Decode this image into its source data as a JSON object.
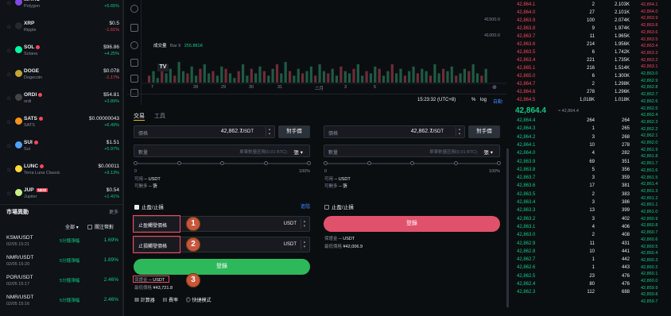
{
  "left_list": [
    {
      "symbol": "MATIC",
      "name": "Polygon",
      "price": "",
      "change": "+5.65%",
      "dir": "pos",
      "color": "#8247e5"
    },
    {
      "symbol": "XRP",
      "name": "Ripple",
      "price": "$0.5",
      "change": "-1.61%",
      "dir": "neg",
      "color": "#23292f"
    },
    {
      "symbol": "SOL",
      "name": "Solana",
      "price": "$96.86",
      "change": "+4.25%",
      "dir": "pos",
      "color": "#00ffa3",
      "hot": true
    },
    {
      "symbol": "DOGE",
      "name": "Dogecoin",
      "price": "$0.078",
      "change": "-1.17%",
      "dir": "neg",
      "color": "#c2a633"
    },
    {
      "symbol": "ORDI",
      "name": "ordi",
      "price": "$54.81",
      "change": "+3.89%",
      "dir": "pos",
      "color": "#444444",
      "hot": true
    },
    {
      "symbol": "SATS",
      "name": "SATS",
      "price": "$0.00000043",
      "change": "+6.49%",
      "dir": "pos",
      "color": "#f7931a",
      "hot": true
    },
    {
      "symbol": "SUI",
      "name": "Sui",
      "price": "$1.51",
      "change": "+5.97%",
      "dir": "pos",
      "color": "#4da2ff",
      "hot": true
    },
    {
      "symbol": "LUNC",
      "name": "Terra Luna Classic",
      "price": "$0.00011",
      "change": "+9.13%",
      "dir": "pos",
      "color": "#ffd83d",
      "hot": true
    },
    {
      "symbol": "JUP",
      "name": "Jupiter",
      "price": "$0.54",
      "change": "+1.41%",
      "dir": "pos",
      "color": "#c7f284",
      "badge": "NEW"
    }
  ],
  "movers": {
    "title": "市場異動",
    "more": "更多",
    "filter_all": "全部",
    "filter_fav": "關注幣對",
    "rows": [
      {
        "pair": "KSM/USDT",
        "time": "02/05 15:21",
        "tag": "5分鐘漲幅",
        "value": "1.69%"
      },
      {
        "pair": "NMR/USDT",
        "time": "02/05 15:20",
        "tag": "5分鐘漲幅",
        "value": "1.89%"
      },
      {
        "pair": "POR/USDT",
        "time": "02/05 15:17",
        "tag": "5分鐘漲幅",
        "value": "2.46%"
      },
      {
        "pair": "NMR/USDT",
        "time": "02/05 15:16",
        "tag": "5分鐘漲幅",
        "value": "2.46%"
      }
    ]
  },
  "chart": {
    "price_labels": [
      "41500.0",
      "41000.0"
    ],
    "volume_label": "成交量",
    "volume_value": "Bar 9",
    "volume_value2": "255.881K",
    "x_ticks": [
      "7",
      "28",
      "29",
      "30",
      "31",
      "二月",
      "3",
      "5"
    ],
    "bars": [
      3,
      5,
      2,
      8,
      4,
      6,
      3,
      9,
      5,
      4,
      7,
      3,
      6,
      8,
      4,
      5,
      3,
      7,
      6,
      4,
      2,
      5,
      8,
      3,
      6,
      4,
      7,
      5,
      3,
      6,
      8,
      4,
      9,
      5,
      3,
      6,
      4,
      5,
      7,
      3,
      8,
      5,
      4,
      6,
      3,
      7,
      5,
      4,
      6,
      8,
      3,
      5,
      4,
      7,
      6,
      3,
      5,
      8,
      4,
      6,
      3,
      5,
      7,
      4,
      6,
      5,
      3,
      8,
      4,
      6,
      5,
      7,
      3,
      4,
      6,
      5,
      8,
      4,
      3,
      6
    ],
    "time": "15:23:32 (UTC+8)",
    "pct": "%",
    "log": "log",
    "auto": "自動"
  },
  "form": {
    "tab_trade": "交易",
    "tab_tools": "工具",
    "price_label": "價格",
    "price_value": "42,862.7",
    "unit": "USDT",
    "counter_price_btn": "對手價",
    "qty_label": "數量",
    "qty_placeholder": "單筆數量區間(0.01 BTC)",
    "qty_unit": "張",
    "slider_min": "0",
    "slider_max": "100%",
    "avail_label": "可用",
    "avail_value": "-- USDT",
    "can_open_label": "可開多",
    "can_open_value": "-- 張",
    "tp_sl_label": "止盈/止損",
    "advanced": "進階",
    "tp_label": "止盈觸發價格",
    "sl_label": "止損觸發價格",
    "buy_label": "登錄",
    "sell_label": "登錄",
    "margin_label": "保證金",
    "margin_value": "-- USDT",
    "est_label": "最低價格",
    "est_value_buy": "¥43,721.8",
    "est_value_sell": "¥42,006.9",
    "calc": "計算器",
    "fee": "費率",
    "mode": "快捷模式",
    "callout_1": "1",
    "callout_2": "2",
    "callout_3": "3"
  },
  "book": {
    "asks": [
      {
        "price": "42,864.1",
        "qty": "2",
        "total": "2.103K"
      },
      {
        "price": "42,864.0",
        "qty": "27",
        "total": "2.101K"
      },
      {
        "price": "42,863.9",
        "qty": "100",
        "total": "2.074K"
      },
      {
        "price": "42,863.8",
        "qty": "9",
        "total": "1.974K"
      },
      {
        "price": "42,863.7",
        "qty": "11",
        "total": "1.965K"
      },
      {
        "price": "42,863.6",
        "qty": "214",
        "total": "1.956K"
      },
      {
        "price": "42,863.5",
        "qty": "6",
        "total": "1.742K"
      },
      {
        "price": "42,863.4",
        "qty": "221",
        "total": "1.735K"
      },
      {
        "price": "42,865.1",
        "qty": "216",
        "total": "1.514K"
      },
      {
        "price": "42,865.0",
        "qty": "6",
        "total": "1.300K"
      },
      {
        "price": "42,864.7",
        "qty": "2",
        "total": "1.298K"
      },
      {
        "price": "42,864.6",
        "qty": "278",
        "total": "1.296K"
      },
      {
        "price": "42,864.5",
        "qty": "1,018K",
        "total": "1.018K"
      }
    ],
    "mid_price": "42,864.4",
    "mid_sub": "≈ 42,864.4",
    "bids": [
      {
        "price": "42,864.4",
        "qty": "264",
        "total": "264"
      },
      {
        "price": "42,864.3",
        "qty": "1",
        "total": "265"
      },
      {
        "price": "42,864.2",
        "qty": "3",
        "total": "268"
      },
      {
        "price": "42,864.1",
        "qty": "10",
        "total": "278"
      },
      {
        "price": "42,864.0",
        "qty": "4",
        "total": "282"
      },
      {
        "price": "42,863.9",
        "qty": "69",
        "total": "351"
      },
      {
        "price": "42,863.8",
        "qty": "5",
        "total": "356"
      },
      {
        "price": "42,863.7",
        "qty": "3",
        "total": "359"
      },
      {
        "price": "42,863.6",
        "qty": "17",
        "total": "381"
      },
      {
        "price": "42,863.5",
        "qty": "2",
        "total": "383"
      },
      {
        "price": "42,863.4",
        "qty": "3",
        "total": "386"
      },
      {
        "price": "42,863.3",
        "qty": "13",
        "total": "399"
      },
      {
        "price": "42,863.2",
        "qty": "3",
        "total": "402"
      },
      {
        "price": "42,863.1",
        "qty": "4",
        "total": "406"
      },
      {
        "price": "42,863.0",
        "qty": "2",
        "total": "408"
      },
      {
        "price": "42,862.9",
        "qty": "11",
        "total": "431"
      },
      {
        "price": "42,862.8",
        "qty": "10",
        "total": "441"
      },
      {
        "price": "42,862.7",
        "qty": "1",
        "total": "442"
      },
      {
        "price": "42,862.6",
        "qty": "1",
        "total": "443"
      },
      {
        "price": "42,862.5",
        "qty": "23",
        "total": "476"
      },
      {
        "price": "42,862.4",
        "qty": "80",
        "total": "476"
      },
      {
        "price": "42,862.3",
        "qty": "112",
        "total": "688"
      }
    ]
  },
  "right_prices_red": [
    "42,864.1",
    "42,864.0",
    "42,863.9",
    "42,863.8",
    "42,863.6",
    "42,863.5",
    "42,863.4",
    "42,863.3",
    "42,863.2",
    "42,863.1"
  ],
  "right_prices_green": [
    "42,863.0",
    "42,862.9",
    "42,862.8",
    "42,862.7",
    "42,862.6",
    "42,862.5",
    "42,862.4",
    "42,862.3",
    "42,862.2",
    "42,862.1",
    "42,862.0",
    "42,861.9",
    "42,861.8",
    "42,861.7",
    "42,861.6",
    "42,861.5",
    "42,861.4",
    "42,861.3",
    "42,861.2",
    "42,861.1",
    "42,861.0",
    "42,860.9",
    "42,860.8",
    "42,860.7",
    "42,860.6",
    "42,860.5",
    "42,860.4",
    "42,860.3",
    "42,860.2",
    "42,860.1",
    "42,860.0",
    "42,859.9",
    "42,859.8",
    "42,859.7"
  ]
}
